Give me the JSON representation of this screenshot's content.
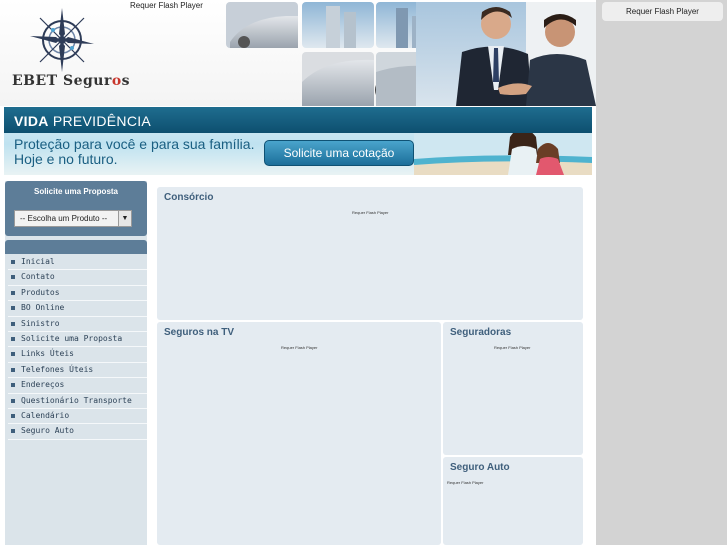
{
  "header": {
    "logo_text_main": "EBET Segur",
    "logo_text_accent": "o",
    "logo_text_end": "s",
    "flash_placeholder": "Requer Flash Player"
  },
  "right_column": {
    "flash_placeholder": "Requer Flash Player"
  },
  "banner": {
    "title_bold": "VIDA",
    "title_rest": " PREVIDÊNCIA",
    "tagline": "Proteção para você e para sua família. Hoje e no futuro.",
    "cta_label": "Solicite uma cotação"
  },
  "sidebar": {
    "proposal_title": "Solicite uma Proposta",
    "product_select_value": "-- Escolha um Produto --",
    "menu": [
      {
        "label": "Inicial"
      },
      {
        "label": "Contato"
      },
      {
        "label": "Produtos"
      },
      {
        "label": "BO Online"
      },
      {
        "label": "Sinistro"
      },
      {
        "label": "Solicite uma Proposta"
      },
      {
        "label": "Links Úteis"
      },
      {
        "label": "Telefones Úteis"
      },
      {
        "label": "Endereços"
      },
      {
        "label": "Questionário Transporte"
      },
      {
        "label": "Calendário"
      },
      {
        "label": "Seguro Auto"
      }
    ]
  },
  "panels": {
    "consorcio": {
      "title": "Consórcio",
      "flash": "Requer Flash Player"
    },
    "seguros_tv": {
      "title": "Seguros na TV",
      "flash": "Requer Flash Player"
    },
    "seguradoras": {
      "title": "Seguradoras",
      "flash": "Requer Flash Player"
    },
    "seguro_auto": {
      "title": "Seguro Auto",
      "flash": "Requer Flash Player"
    }
  },
  "colors": {
    "accent": "#5d7d98",
    "panel_bg": "#e4ebf1",
    "banner_blue": "#1f6d8f",
    "logo_accent": "#c8362c"
  }
}
